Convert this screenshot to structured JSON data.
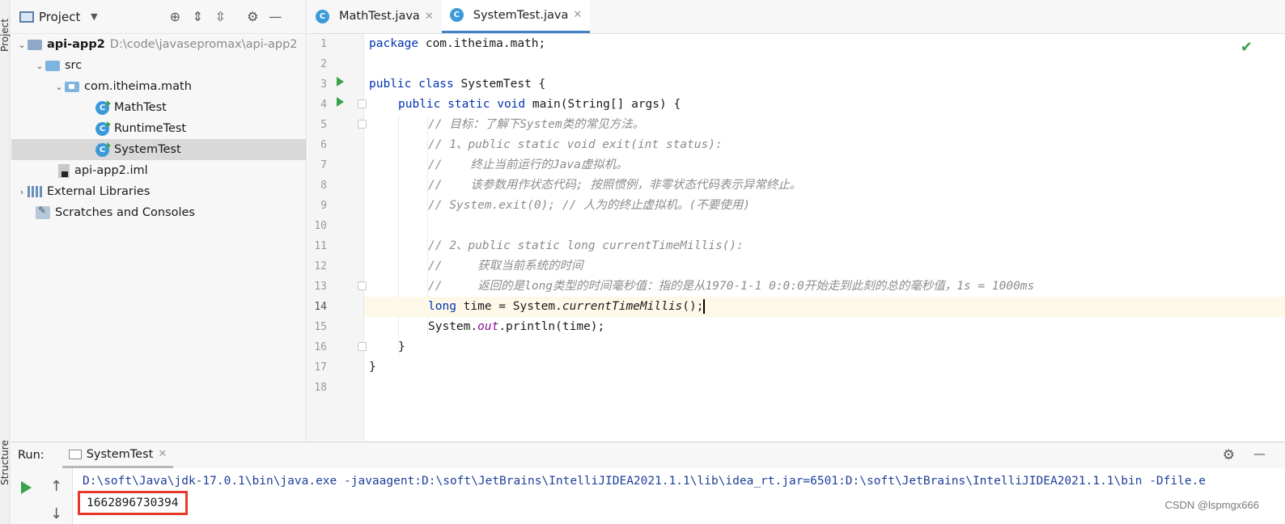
{
  "tool_strip": {
    "project": "Project",
    "structure": "Structure"
  },
  "project_pane": {
    "title": "Project",
    "tree": [
      {
        "label": "api-app2",
        "path": "D:\\code\\javasepromax\\api-app2"
      },
      {
        "label": "src"
      },
      {
        "label": "com.itheima.math"
      },
      {
        "label": "MathTest"
      },
      {
        "label": "RuntimeTest"
      },
      {
        "label": "SystemTest"
      },
      {
        "label": "api-app2.iml"
      },
      {
        "label": "External Libraries"
      },
      {
        "label": "Scratches and Consoles"
      }
    ]
  },
  "editor": {
    "tabs": [
      {
        "label": "MathTest.java"
      },
      {
        "label": "SystemTest.java"
      }
    ],
    "line_numbers": [
      "1",
      "2",
      "3",
      "4",
      "5",
      "6",
      "7",
      "8",
      "9",
      "10",
      "11",
      "12",
      "13",
      "14",
      "15",
      "16",
      "17",
      "18"
    ],
    "code": {
      "l1_kw": "package",
      "l1_rest": " com.itheima.math;",
      "l3_kw": "public class",
      "l3_rest": " SystemTest {",
      "l4_kw": "public static void",
      "l4_rest": " main(String[] args) {",
      "l5": "// 目标：了解下System类的常见方法。",
      "l6": "// 1、public static void exit(int status):",
      "l7": "//    终止当前运行的Java虚拟机。",
      "l8": "//    该参数用作状态代码; 按照惯例，非零状态代码表示异常终止。",
      "l9": "// System.exit(0); // 人为的终止虚拟机。(不要使用)",
      "l11": "// 2、public static long currentTimeMillis():",
      "l12": "//     获取当前系统的时间",
      "l13": "//     返回的是long类型的时间毫秒值：指的是从1970-1-1 0:0:0开始走到此刻的总的毫秒值，1s = 1000ms",
      "l14_kw": "long",
      "l14_a": " time = System.",
      "l14_m": "currentTimeMillis",
      "l14_b": "();",
      "l15_a": "System.",
      "l15_f": "out",
      "l15_b": ".println(time);",
      "l16": "}",
      "l17": "}"
    }
  },
  "run_panel": {
    "label": "Run:",
    "tab": "SystemTest",
    "command": "D:\\soft\\Java\\jdk-17.0.1\\bin\\java.exe -javaagent:D:\\soft\\JetBrains\\IntelliJIDEA2021.1.1\\lib\\idea_rt.jar=6501:D:\\soft\\JetBrains\\IntelliJIDEA2021.1.1\\bin -Dfile.e",
    "output": "1662896730394"
  },
  "watermark": "CSDN @lspmgx666",
  "colors": {
    "keyword": "#0033b3",
    "comment": "#8c8c8c",
    "field": "#871094",
    "highlight_box": "#e53a2a"
  }
}
